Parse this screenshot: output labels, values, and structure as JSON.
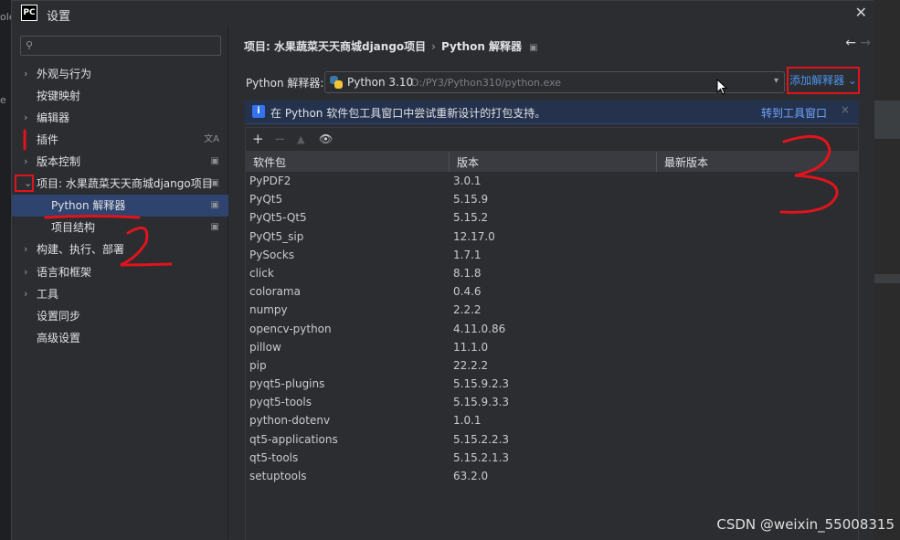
{
  "window": {
    "app_logo_text": "PC",
    "title": "设置",
    "close_glyph": "✕"
  },
  "left_edge": {
    "frag1": "ole",
    "frag2": "e"
  },
  "sidebar": {
    "search_placeholder": "",
    "items": [
      {
        "label": "外观与行为",
        "arrow": "›"
      },
      {
        "label": "按键映射"
      },
      {
        "label": "编辑器",
        "arrow": "›"
      },
      {
        "label": "插件",
        "badge": "文A"
      },
      {
        "label": "版本控制",
        "arrow": "›",
        "badge": "▣"
      },
      {
        "label": "项目: 水果蔬菜天天商城django项目",
        "arrow": "⌄",
        "badge": "▣"
      },
      {
        "label": "Python 解释器",
        "badge": "▣"
      },
      {
        "label": "项目结构",
        "badge": "▣"
      },
      {
        "label": "构建、执行、部署",
        "arrow": "›"
      },
      {
        "label": "语言和框架",
        "arrow": "›"
      },
      {
        "label": "工具",
        "arrow": "›"
      },
      {
        "label": "设置同步"
      },
      {
        "label": "高级设置"
      }
    ]
  },
  "main": {
    "breadcrumb": {
      "project": "项目: 水果蔬菜天天商城django项目",
      "sep": "›",
      "page": "Python 解释器",
      "pin": "▣"
    },
    "nav": {
      "back": "←",
      "forward": "→"
    },
    "interpreter": {
      "label": "Python 解释器:",
      "name": "Python 3.10",
      "path": "D:/PY3/Python310/python.exe",
      "caret": "▾",
      "add_button": "添加解释器 ⌄"
    },
    "banner": {
      "info_glyph": "i",
      "text": "在 Python 软件包工具窗口中尝试重新设计的打包支持。",
      "link": "转到工具窗口",
      "close": "×"
    },
    "toolbar": {
      "add": "+",
      "remove": "−",
      "up": "▲",
      "show": "👁"
    },
    "table": {
      "columns": [
        "软件包",
        "版本",
        "最新版本"
      ],
      "rows": [
        [
          "PyPDF2",
          "3.0.1",
          ""
        ],
        [
          "PyQt5",
          "5.15.9",
          ""
        ],
        [
          "PyQt5-Qt5",
          "5.15.2",
          ""
        ],
        [
          "PyQt5_sip",
          "12.17.0",
          ""
        ],
        [
          "PySocks",
          "1.7.1",
          ""
        ],
        [
          "click",
          "8.1.8",
          ""
        ],
        [
          "colorama",
          "0.4.6",
          ""
        ],
        [
          "numpy",
          "2.2.2",
          ""
        ],
        [
          "opencv-python",
          "4.11.0.86",
          ""
        ],
        [
          "pillow",
          "11.1.0",
          ""
        ],
        [
          "pip",
          "22.2.2",
          ""
        ],
        [
          "pyqt5-plugins",
          "5.15.9.2.3",
          ""
        ],
        [
          "pyqt5-tools",
          "5.15.9.3.3",
          ""
        ],
        [
          "python-dotenv",
          "1.0.1",
          ""
        ],
        [
          "qt5-applications",
          "5.15.2.2.3",
          ""
        ],
        [
          "qt5-tools",
          "5.15.2.1.3",
          ""
        ],
        [
          "setuptools",
          "63.2.0",
          ""
        ]
      ]
    }
  },
  "watermark": "CSDN @weixin_55008315",
  "colors": {
    "accent": "#3574f0",
    "annotation_red": "#e0141c",
    "link": "#4d93ed",
    "selection": "#2e436e"
  }
}
